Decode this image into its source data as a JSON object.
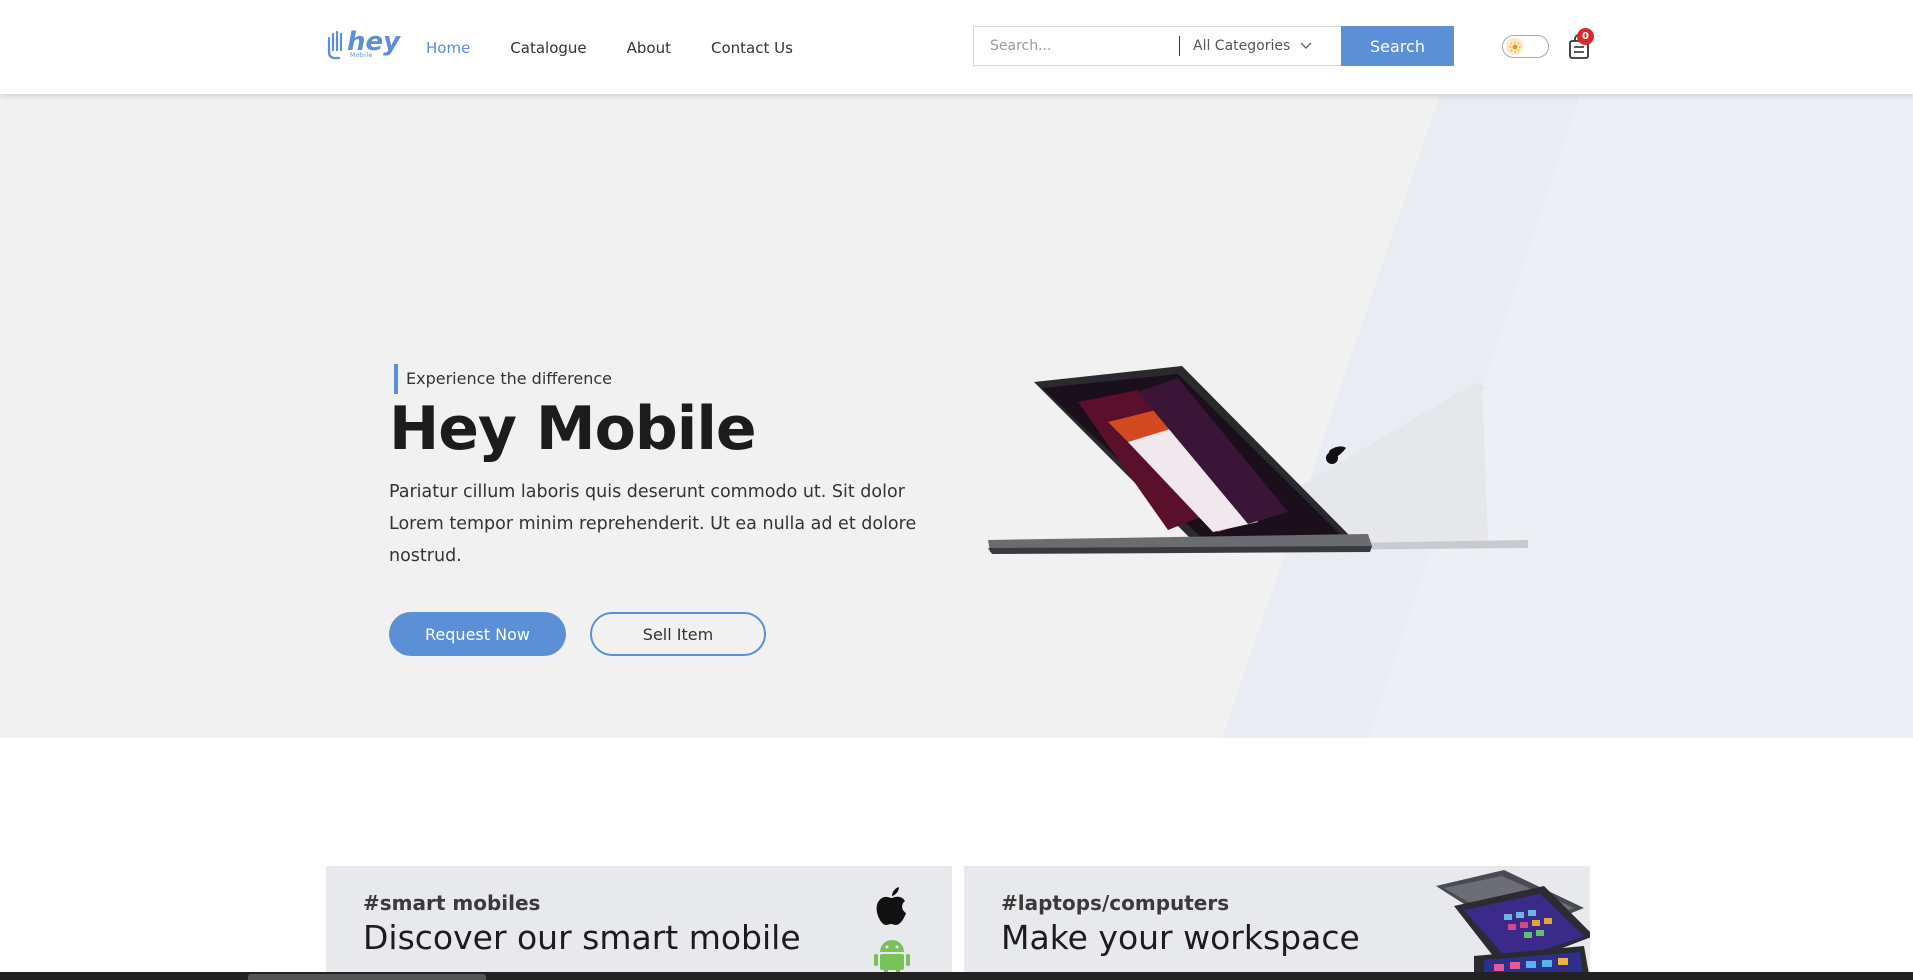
{
  "header": {
    "logo_text": "hey",
    "logo_subtext": "Mobile",
    "nav": [
      {
        "label": "Home",
        "active": true
      },
      {
        "label": "Catalogue",
        "active": false
      },
      {
        "label": "About",
        "active": false
      },
      {
        "label": "Contact Us",
        "active": false
      }
    ],
    "search": {
      "placeholder": "Search...",
      "category_selected": "All Categories",
      "button_label": "Search"
    },
    "theme_toggle_icon": "sun-icon",
    "cart_icon": "shopping-bag-icon",
    "cart_count": "0"
  },
  "hero": {
    "tagline": "Experience the difference",
    "title": "Hey Mobile",
    "description": "Pariatur cillum laboris quis deserunt commodo ut. Sit dolor Lorem tempor minim reprehenderit. Ut ea nulla ad et dolore nostrud.",
    "primary_button": "Request Now",
    "secondary_button": "Sell Item",
    "image": "laptop-image"
  },
  "cards": [
    {
      "tag": "#smart mobiles",
      "heading": "Discover our smart mobile",
      "icons": [
        "apple-icon",
        "android-icon"
      ]
    },
    {
      "tag": "#laptops/computers",
      "heading": "Make your workspace",
      "image": "tablets-image"
    }
  ],
  "colors": {
    "accent": "#5b8fd6",
    "hero_bg": "#f1f1f1",
    "card_bg": "#e8e9ec",
    "badge": "#d92b2b"
  }
}
